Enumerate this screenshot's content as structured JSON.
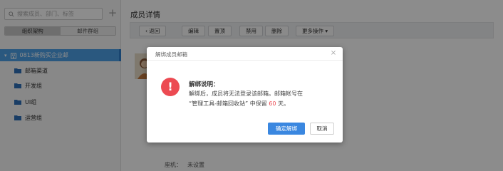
{
  "sidebar": {
    "search_placeholder": "搜索成员、部门、标签",
    "add_icon": "+",
    "segments": [
      {
        "label": "组织架构",
        "active": true
      },
      {
        "label": "邮件群组",
        "active": false
      }
    ],
    "org_root": {
      "label": "0813新购买企业邮"
    },
    "departments": [
      {
        "label": "邮箱渠道"
      },
      {
        "label": "开发组"
      },
      {
        "label": "UI组"
      },
      {
        "label": "运营组"
      }
    ]
  },
  "main": {
    "title": "成员详情",
    "toolbar": {
      "back": "返回",
      "edit": "编辑",
      "pin": "置顶",
      "disable": "禁用",
      "delete": "删除",
      "more": "更多操作"
    },
    "phone_label": "座机：",
    "phone_value": "未设置"
  },
  "modal": {
    "title": "解绑成员邮箱",
    "close_icon": "×",
    "icon": "!",
    "icon_color": "#ec4a52",
    "message_title": "解绑说明：",
    "line1": "解绑后，成员将无法登录该邮箱。邮箱帐号在",
    "line2_prefix": "“管理工具-邮箱回收站” 中保留",
    "line2_days": "60",
    "line2_suffix": "天。",
    "confirm_label": "确定解绑",
    "cancel_label": "取消",
    "primary_color": "#3a87e0"
  }
}
